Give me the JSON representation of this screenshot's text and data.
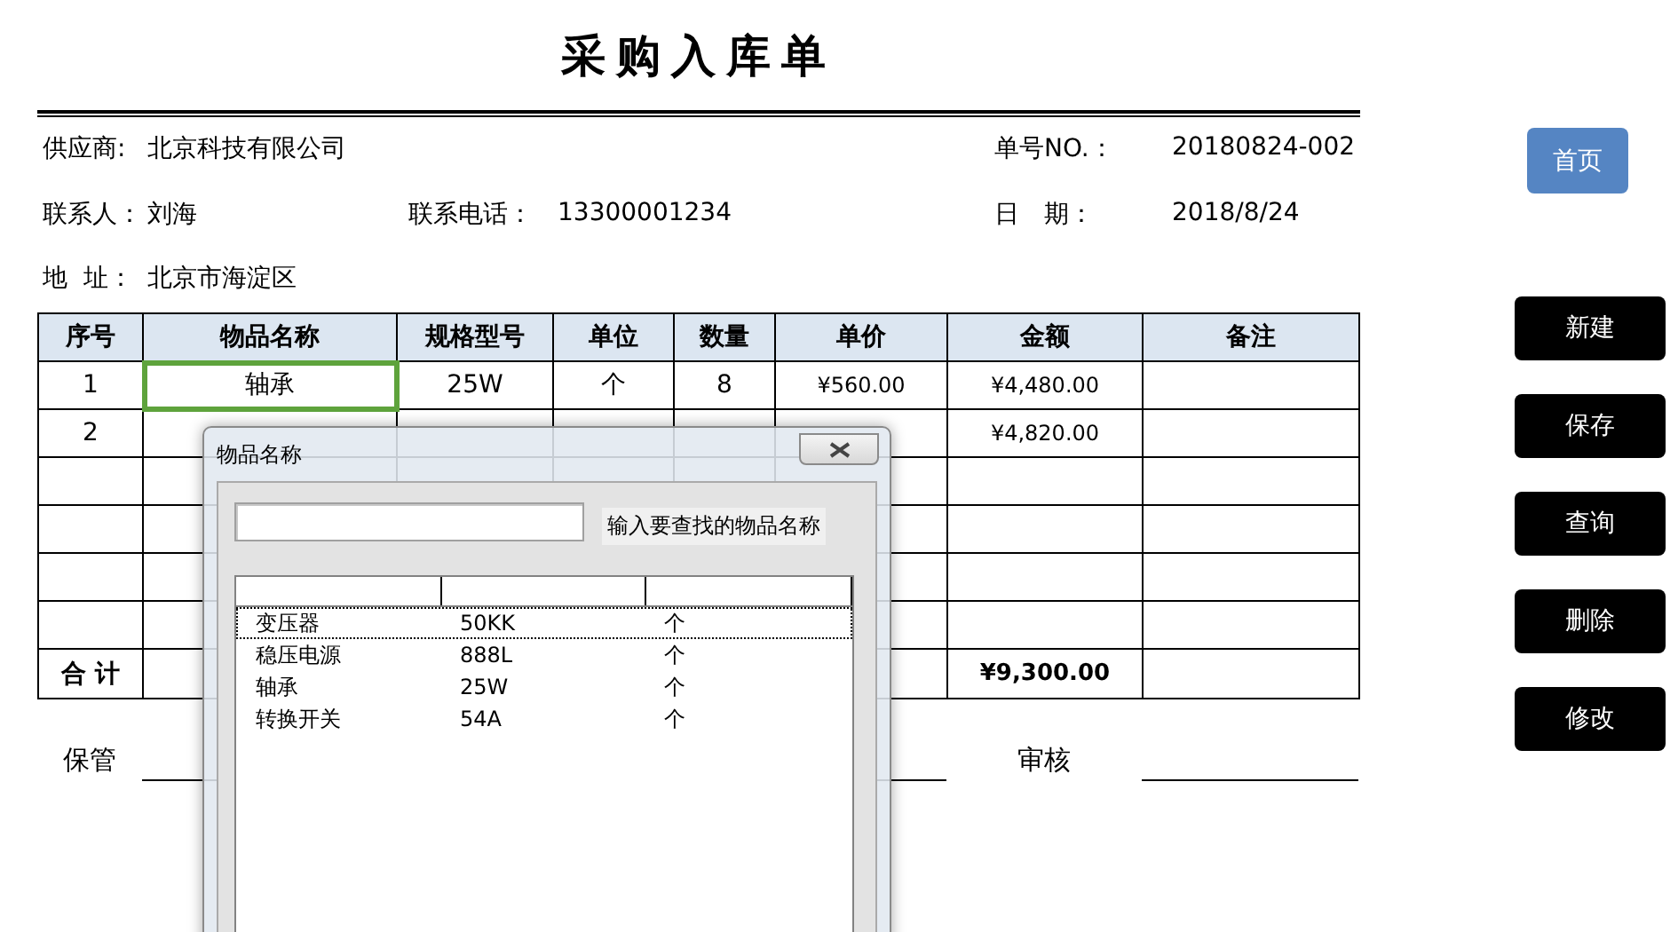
{
  "title": "采购入库单",
  "info_rows": [
    [
      {
        "kind": "left",
        "label": "供应商:",
        "value": "北京科技有限公司"
      },
      {
        "kind": "right",
        "label": "单号NO.：",
        "value": "20180824-002"
      }
    ],
    [
      {
        "kind": "left",
        "label": "联系人：",
        "value": "刘海"
      },
      {
        "kind": "middle",
        "label": "联系电话：",
        "value": "13300001234"
      },
      {
        "kind": "right",
        "label": "日　期：",
        "value": "2018/8/24"
      }
    ],
    [
      {
        "kind": "left",
        "label": "地  址：",
        "value": "北京市海淀区"
      }
    ]
  ],
  "table": {
    "columns": [
      "序号",
      "物品名称",
      "规格型号",
      "单位",
      "数量",
      "单价",
      "金额",
      "备注"
    ],
    "rows": [
      {
        "no": "1",
        "name": "轴承",
        "spec": "25W",
        "unit": "个",
        "qty": "8",
        "price": "¥560.00",
        "amount": "¥4,480.00",
        "name_selected": true
      },
      {
        "no": "2",
        "amount": "¥4,820.00",
        "name_selected": false
      },
      {
        "name_selected": false
      },
      {
        "name_selected": false
      },
      {
        "name_selected": false
      },
      {
        "name_selected": false
      }
    ],
    "total": {
      "label": "合 计",
      "amount": "¥9,300.00"
    }
  },
  "signatures": [
    {
      "label": "保管"
    },
    {
      "label": "审核"
    }
  ],
  "buttons": [
    {
      "label": "首页",
      "kind": "nav"
    },
    {
      "label": "新建",
      "kind": "action"
    },
    {
      "label": "保存",
      "kind": "action"
    },
    {
      "label": "查询",
      "kind": "action"
    },
    {
      "label": "删除",
      "kind": "action"
    },
    {
      "label": "修改",
      "kind": "action"
    }
  ],
  "dialog": {
    "title": "物品名称",
    "search_hint": "输入要查找的物品名称",
    "items": [
      {
        "name": "变压器",
        "spec": "50KK",
        "unit": "个",
        "selected": true
      },
      {
        "name": "稳压电源",
        "spec": "888L",
        "unit": "个",
        "selected": false
      },
      {
        "name": "轴承",
        "spec": "25W",
        "unit": "个",
        "selected": false
      },
      {
        "name": "转换开关",
        "spec": "54A",
        "unit": "个",
        "selected": false
      }
    ]
  }
}
